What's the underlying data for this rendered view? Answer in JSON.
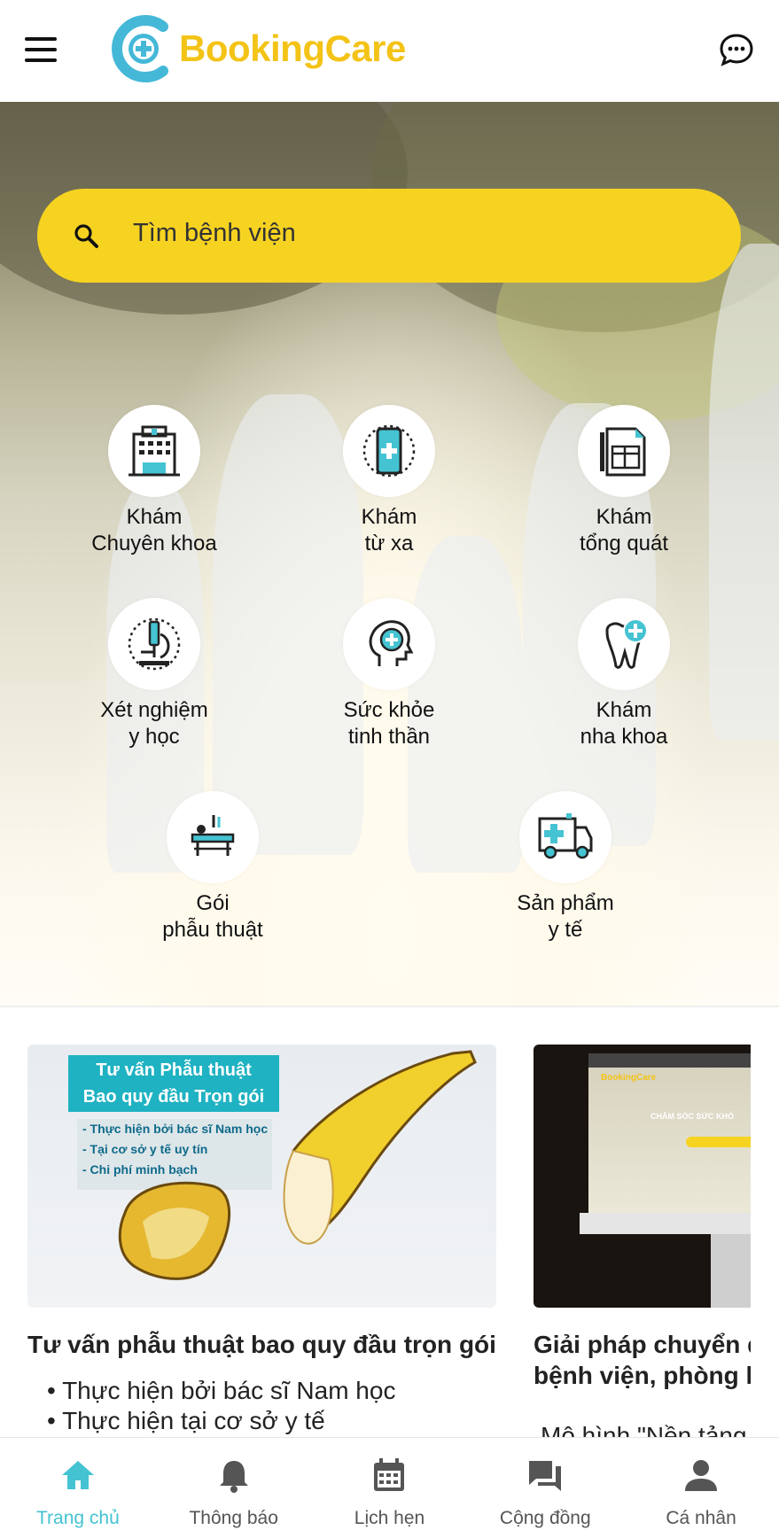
{
  "header": {
    "brand": "BookingCare",
    "menu_icon": "hamburger-menu-icon",
    "chat_icon": "chat-bubble-icon"
  },
  "colors": {
    "brand_yellow": "#f3c316",
    "search_yellow": "#f6d321",
    "accent_teal": "#45c3d2",
    "logo_blue": "#45b8d8"
  },
  "search": {
    "placeholder": "Tìm bệnh viện",
    "icon": "search-icon"
  },
  "services": [
    {
      "label": "Khám\nChuyên khoa",
      "icon": "hospital-building-icon"
    },
    {
      "label": "Khám\ntừ xa",
      "icon": "phone-medical-icon"
    },
    {
      "label": "Khám\ntổng quát",
      "icon": "clipboard-form-icon"
    },
    {
      "label": "Xét nghiệm\ny học",
      "icon": "microscope-icon"
    },
    {
      "label": "Sức khỏe\ntinh thần",
      "icon": "head-mind-icon"
    },
    {
      "label": "Khám\nnha khoa",
      "icon": "tooth-icon"
    },
    {
      "label": "Gói\nphẫu thuật",
      "icon": "surgery-bed-icon"
    },
    {
      "label": "Sản phẩm\ny tế",
      "icon": "ambulance-icon"
    }
  ],
  "cards": [
    {
      "title": "Tư vấn phẫu thuật bao quy đầu trọn gói",
      "image_heading_1": "Tư vấn Phẫu thuật",
      "image_heading_2": "Bao quy đầu Trọn gói",
      "image_points": [
        "- Thực hiện bởi bác sĩ Nam học",
        "- Tại cơ sở y tế uy tín",
        "- Chi phí minh bạch"
      ],
      "bullets": [
        "Thực hiện bởi bác sĩ Nam học",
        "Thực hiện tại cơ sở y tế"
      ]
    },
    {
      "title": "Giải pháp chuyển đ\nbệnh viện, phòng k",
      "screen_brand": "BookingCare",
      "screen_headline": "CHĂM SÓC SỨC KHỎ",
      "snippet": "Mô hình \"Nền tảng"
    }
  ],
  "bottom_nav": [
    {
      "label": "Trang chủ",
      "icon": "home-icon",
      "active": true
    },
    {
      "label": "Thông báo",
      "icon": "bell-icon",
      "active": false
    },
    {
      "label": "Lịch hẹn",
      "icon": "calendar-icon",
      "active": false
    },
    {
      "label": "Cộng đồng",
      "icon": "chat-forum-icon",
      "active": false
    },
    {
      "label": "Cá nhân",
      "icon": "person-icon",
      "active": false
    }
  ]
}
